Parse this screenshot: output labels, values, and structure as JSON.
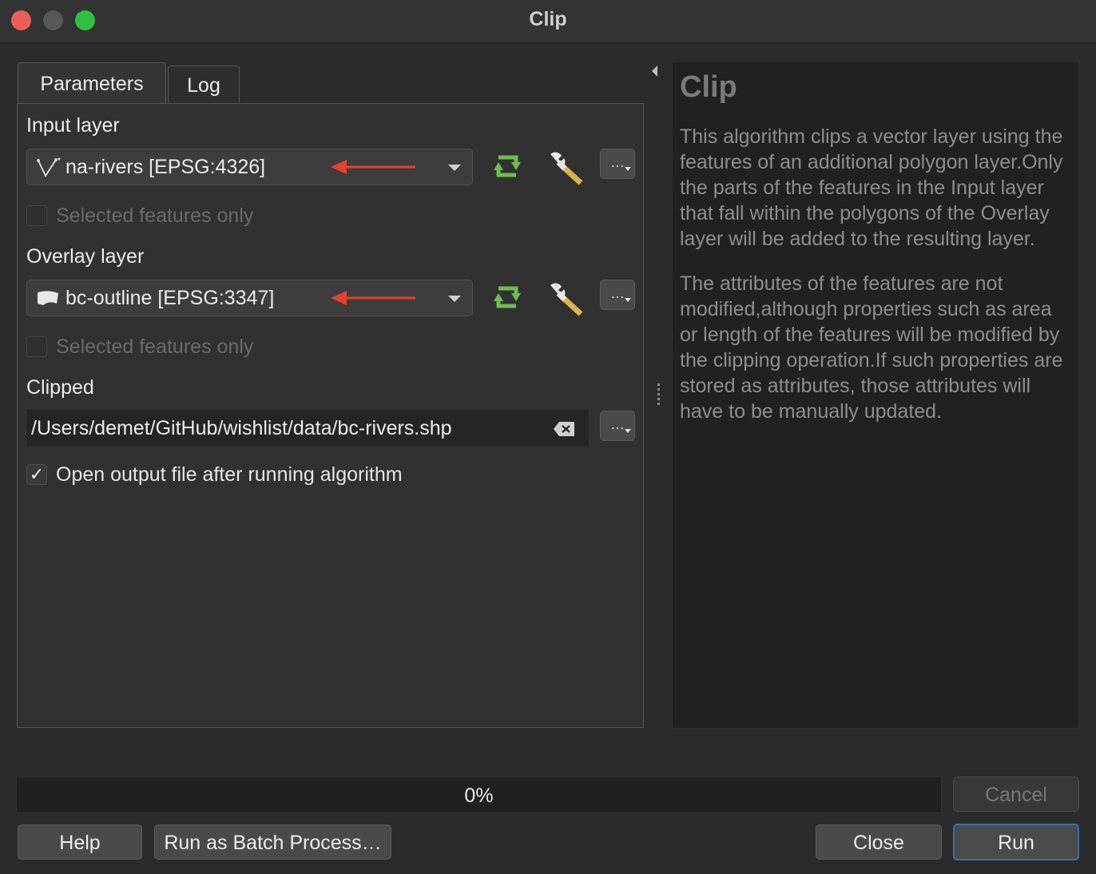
{
  "window": {
    "title": "Clip"
  },
  "tabs": {
    "parameters": "Parameters",
    "log": "Log"
  },
  "input_layer": {
    "label": "Input layer",
    "value": "na-rivers [EPSG:4326]",
    "selected_only": "Selected features only",
    "selected_only_checked": false
  },
  "overlay_layer": {
    "label": "Overlay layer",
    "value": "bc-outline [EPSG:3347]",
    "selected_only": "Selected features only",
    "selected_only_checked": false
  },
  "clipped": {
    "label": "Clipped",
    "value": "/Users/demet/GitHub/wishlist/data/bc-rivers.shp",
    "open_after": "Open output file after running algorithm",
    "open_after_checked": true
  },
  "browse_button": "…",
  "help": {
    "title": "Clip",
    "paragraph1": "This algorithm clips a vector layer using the features of an additional polygon layer.Only the parts of the features in the Input layer that fall within the polygons of the Overlay layer will be added to the resulting layer.",
    "paragraph2": "The attributes of the features are not modified,although properties such as area or length of the features will be modified by the clipping operation.If such properties are stored as attributes, those attributes will have to be manually updated."
  },
  "progress": {
    "text": "0%",
    "value": 0
  },
  "buttons": {
    "cancel": "Cancel",
    "help": "Help",
    "batch": "Run as Batch Process…",
    "close": "Close",
    "run": "Run"
  },
  "colors": {
    "annotation_arrow": "#e8412c",
    "iterate_icon": "#6cc04a",
    "run_focus": "#3b6fb0"
  }
}
